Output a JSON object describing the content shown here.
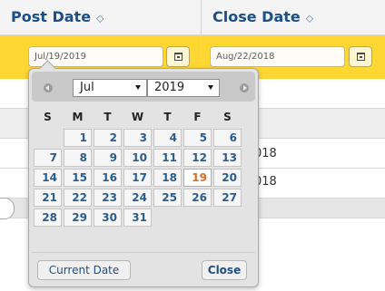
{
  "table": {
    "columns": [
      {
        "label": "Post Date",
        "sort_icon": "⬦"
      },
      {
        "label": "Close Date",
        "sort_icon": "⬦"
      }
    ],
    "post_date_value": "Jul/19/2019",
    "close_date_value": "Aug/22/2018",
    "row_fragments": [
      "018",
      "018"
    ]
  },
  "datepicker": {
    "month": "Jul",
    "year": "2019",
    "weekdays": [
      "S",
      "M",
      "T",
      "W",
      "T",
      "F",
      "S"
    ],
    "days": [
      "1",
      "2",
      "3",
      "4",
      "5",
      "6",
      "7",
      "8",
      "9",
      "10",
      "11",
      "12",
      "13",
      "14",
      "15",
      "16",
      "17",
      "18",
      "19",
      "20",
      "21",
      "22",
      "23",
      "24",
      "25",
      "26",
      "27",
      "28",
      "29",
      "30",
      "31"
    ],
    "first_weekday_index": 1,
    "today": "19",
    "current_date_button": "Current Date",
    "close_button": "Close"
  },
  "colors": {
    "header_text": "#1c4f88",
    "selected_row": "#ffd733",
    "today_text": "#de6b20",
    "day_text": "#2a5d8f"
  }
}
